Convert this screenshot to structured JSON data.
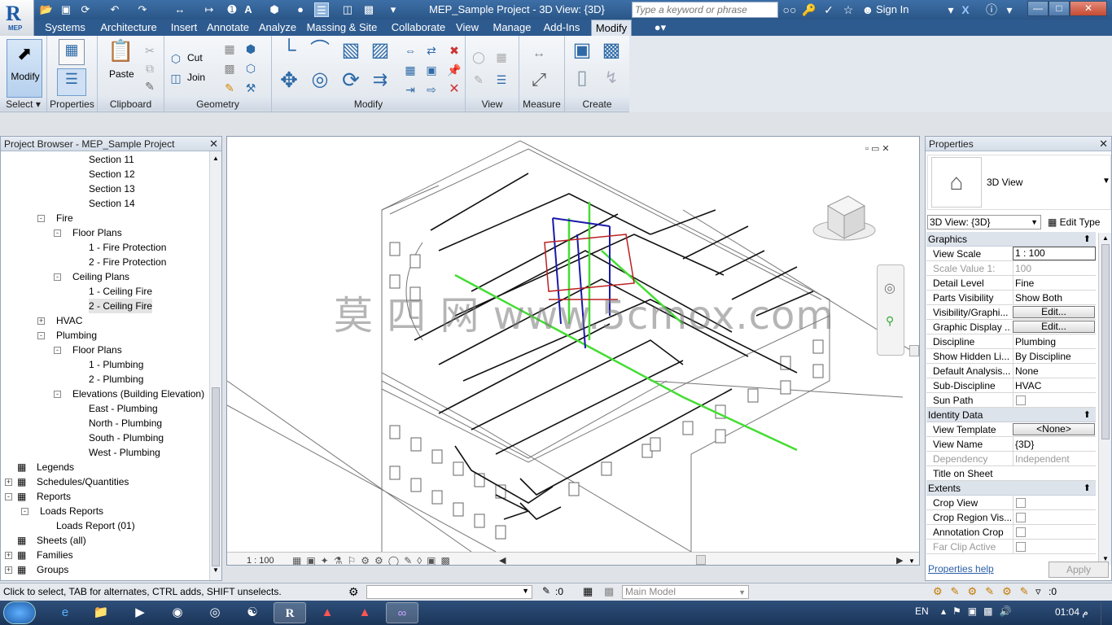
{
  "window": {
    "title": "MEP_Sample Project - 3D View: {3D}",
    "search_placeholder": "Type a keyword or phrase",
    "sign_in": "Sign In",
    "app_label": "MEP"
  },
  "menu": [
    "Systems",
    "Architecture",
    "Insert",
    "Annotate",
    "Analyze",
    "Massing & Site",
    "Collaborate",
    "View",
    "Manage",
    "Add-Ins",
    "Modify"
  ],
  "ribbon": {
    "modify_btn": "Modify",
    "paste": "Paste",
    "cut": "Cut",
    "join": "Join",
    "panels": [
      "Select",
      "Properties",
      "Clipboard",
      "Geometry",
      "Modify",
      "View",
      "Measure",
      "Create"
    ]
  },
  "project_browser": {
    "title": "Project Browser - MEP_Sample Project",
    "items": [
      {
        "label": "Section 11",
        "level": 4
      },
      {
        "label": "Section 12",
        "level": 4
      },
      {
        "label": "Section 13",
        "level": 4
      },
      {
        "label": "Section 14",
        "level": 4
      },
      {
        "label": "Fire",
        "level": 2,
        "exp": "-"
      },
      {
        "label": "Floor Plans",
        "level": 3,
        "exp": "-"
      },
      {
        "label": "1 - Fire Protection",
        "level": 4
      },
      {
        "label": "2 - Fire Protection",
        "level": 4
      },
      {
        "label": "Ceiling Plans",
        "level": 3,
        "exp": "-"
      },
      {
        "label": "1 - Ceiling Fire",
        "level": 4
      },
      {
        "label": "2 - Ceiling Fire",
        "level": 4,
        "selected": true
      },
      {
        "label": "HVAC",
        "level": 2,
        "exp": "+"
      },
      {
        "label": "Plumbing",
        "level": 2,
        "exp": "-"
      },
      {
        "label": "Floor Plans",
        "level": 3,
        "exp": "-"
      },
      {
        "label": "1 - Plumbing",
        "level": 4
      },
      {
        "label": "2 - Plumbing",
        "level": 4
      },
      {
        "label": "Elevations (Building Elevation)",
        "level": 3,
        "exp": "-"
      },
      {
        "label": "East - Plumbing",
        "level": 4
      },
      {
        "label": "North - Plumbing",
        "level": 4
      },
      {
        "label": "South - Plumbing",
        "level": 4
      },
      {
        "label": "West - Plumbing",
        "level": 4
      },
      {
        "label": "Legends",
        "level": 0,
        "icon": true
      },
      {
        "label": "Schedules/Quantities",
        "level": 0,
        "exp": "+",
        "icon": true
      },
      {
        "label": "Reports",
        "level": 0,
        "exp": "-",
        "icon": true
      },
      {
        "label": "Loads Reports",
        "level": 1,
        "exp": "-"
      },
      {
        "label": "Loads Report (01)",
        "level": 2
      },
      {
        "label": "Sheets (all)",
        "level": 0,
        "icon": true
      },
      {
        "label": "Families",
        "level": 0,
        "exp": "+",
        "icon": true
      },
      {
        "label": "Groups",
        "level": 0,
        "exp": "+",
        "icon": true
      }
    ]
  },
  "viewport": {
    "scale": "1 : 100",
    "watermark": "莫 四 网 www.5cmox.com"
  },
  "properties": {
    "title": "Properties",
    "type_name": "3D View",
    "selector": "3D View: {3D}",
    "edit_type": "Edit Type",
    "groups": {
      "graphics": "Graphics",
      "identity": "Identity Data",
      "extents": "Extents"
    },
    "graphics": [
      {
        "k": "View Scale",
        "v": "1 : 100",
        "box": true
      },
      {
        "k": "Scale Value    1:",
        "v": "100",
        "dim": true
      },
      {
        "k": "Detail Level",
        "v": "Fine"
      },
      {
        "k": "Parts Visibility",
        "v": "Show Both"
      },
      {
        "k": "Visibility/Graphi...",
        "v": "Edit...",
        "btn": true
      },
      {
        "k": "Graphic Display ...",
        "v": "Edit...",
        "btn": true
      },
      {
        "k": "Discipline",
        "v": "Plumbing"
      },
      {
        "k": "Show Hidden Li...",
        "v": "By Discipline"
      },
      {
        "k": "Default Analysis...",
        "v": "None"
      },
      {
        "k": "Sub-Discipline",
        "v": "HVAC"
      },
      {
        "k": "Sun Path",
        "v": "",
        "chk": true
      }
    ],
    "identity": [
      {
        "k": "View Template",
        "v": "<None>",
        "btn": true
      },
      {
        "k": "View Name",
        "v": "{3D}"
      },
      {
        "k": "Dependency",
        "v": "Independent",
        "dim": true
      },
      {
        "k": "Title on Sheet",
        "v": ""
      }
    ],
    "extents": [
      {
        "k": "Crop View",
        "v": "",
        "chk": true
      },
      {
        "k": "Crop Region Vis...",
        "v": "",
        "chk": true
      },
      {
        "k": "Annotation Crop",
        "v": "",
        "chk": true
      },
      {
        "k": "Far Clip Active",
        "v": "",
        "chk": true,
        "dim": true
      }
    ],
    "help": "Properties help",
    "apply": "Apply"
  },
  "status": {
    "hint": "Click to select, TAB for alternates, CTRL adds, SHIFT unselects.",
    "zero": ":0",
    "model": "Main Model",
    "filter": ":0"
  },
  "taskbar": {
    "lang": "EN",
    "time": "01:04 م"
  }
}
